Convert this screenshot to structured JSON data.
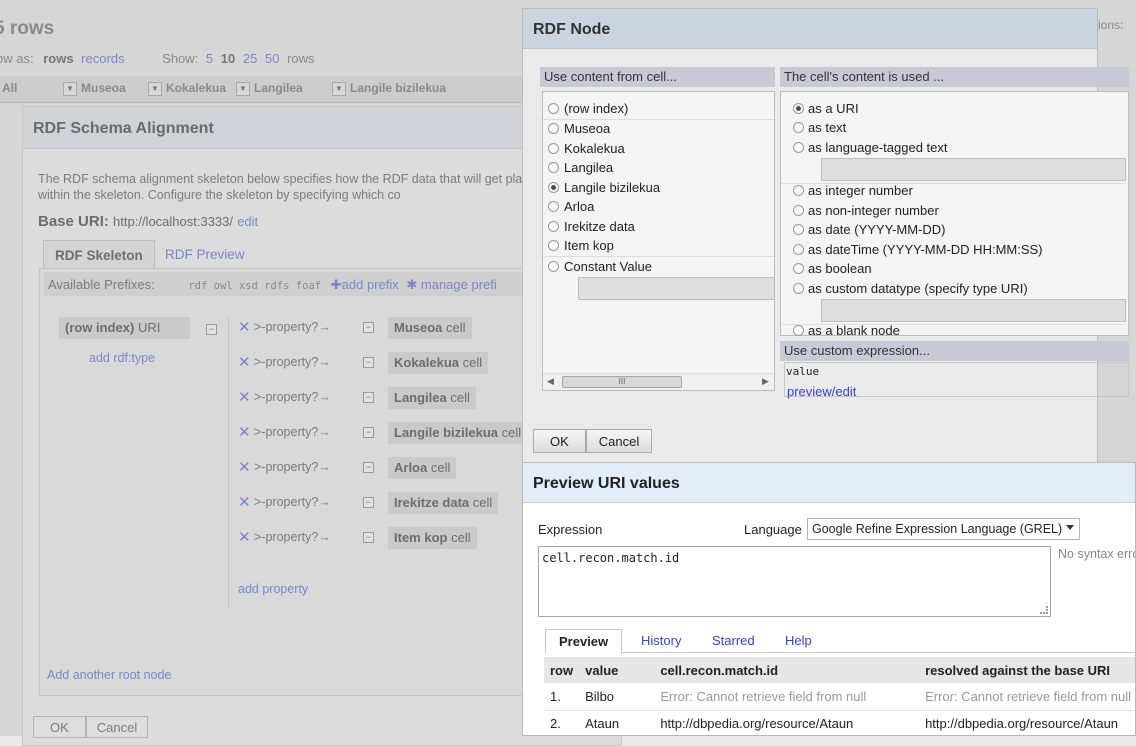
{
  "background": {
    "row_count_title": "5 rows",
    "show_as_label": "ow as:",
    "show_as_rows": "rows",
    "show_as_records": "records",
    "show_label": "Show:",
    "show_options": [
      "5",
      "10",
      "25",
      "50"
    ],
    "show_suffix": "rows",
    "all_label": "All",
    "columns": [
      "Museoa",
      "Kokalekua",
      "Langilea",
      "Langile bizilekua"
    ],
    "right_control": "ions:"
  },
  "schema_dialog": {
    "title": "RDF Schema Alignment",
    "description": "The RDF schema alignment skeleton below specifies how the RDF data that will get placed into nodes within the skeleton. Configure the skeleton by specifying which co",
    "base_uri_label": "Base URI:",
    "base_uri_value": "http://localhost:3333/",
    "base_uri_edit": "edit",
    "tabs": [
      "RDF Skeleton",
      "RDF Preview"
    ],
    "prefixes_label": "Available Prefixes:",
    "prefixes": "rdf owl xsd rdfs foaf",
    "add_prefix": "add prefix",
    "manage_prefixes": "manage prefi",
    "root_node_name": "(row index)",
    "root_node_suffix": "URI",
    "add_rdf_type": "add rdf:type",
    "property_placeholder": "property?",
    "properties": [
      {
        "name": "Museoa",
        "suffix": "cell"
      },
      {
        "name": "Kokalekua",
        "suffix": "cell"
      },
      {
        "name": "Langilea",
        "suffix": "cell"
      },
      {
        "name": "Langile bizilekua",
        "suffix": "cell"
      },
      {
        "name": "Arloa",
        "suffix": "cell"
      },
      {
        "name": "Irekitze data",
        "suffix": "cell"
      },
      {
        "name": "Item kop",
        "suffix": "cell"
      }
    ],
    "add_property": "add property",
    "add_root_node": "Add another root node",
    "ok_label": "OK",
    "cancel_label": "Cancel"
  },
  "node_dialog": {
    "title": "RDF Node",
    "use_content_header": "Use content from cell...",
    "cell_options": [
      "(row index)",
      "Museoa",
      "Kokalekua",
      "Langilea",
      "Langile bizilekua",
      "Arloa",
      "Irekitze data",
      "Item kop",
      "Constant Value"
    ],
    "cell_selected": "Langile bizilekua",
    "content_used_header": "The cell's content is used ...",
    "use_options": [
      "as a URI",
      "as text",
      "as language-tagged text",
      "as integer number",
      "as non-integer number",
      "as date (YYYY-MM-DD)",
      "as dateTime (YYYY-MM-DD HH:MM:SS)",
      "as boolean",
      "as custom datatype (specify type URI)",
      "as a blank node"
    ],
    "use_selected": "as a URI",
    "custom_expr_header": "Use custom expression...",
    "custom_expr_value": "value",
    "preview_edit": "preview/edit",
    "ok_label": "OK",
    "cancel_label": "Cancel"
  },
  "preview_dialog": {
    "title": "Preview URI values",
    "expression_label": "Expression",
    "language_label": "Language",
    "language_value": "Google Refine Expression Language (GREL)",
    "expression": "cell.recon.match.id",
    "syntax_status": "No syntax erro",
    "tabs": [
      "Preview",
      "History",
      "Starred",
      "Help"
    ],
    "columns": [
      "row",
      "value",
      "cell.recon.match.id",
      "resolved against the base URI"
    ],
    "rows": [
      {
        "row": "1.",
        "value": "Bilbo",
        "expr": "Error: Cannot retrieve field from null",
        "resolved": "Error: Cannot retrieve field from null"
      },
      {
        "row": "2.",
        "value": "Ataun",
        "expr": "http://dbpedia.org/resource/Ataun",
        "resolved": "http://dbpedia.org/resource/Ataun"
      }
    ]
  },
  "colors": {
    "link": "#3344dd",
    "node_header": "#cad5df",
    "section_header": "#c9c9d6",
    "preview_header": "#e3edf8"
  }
}
